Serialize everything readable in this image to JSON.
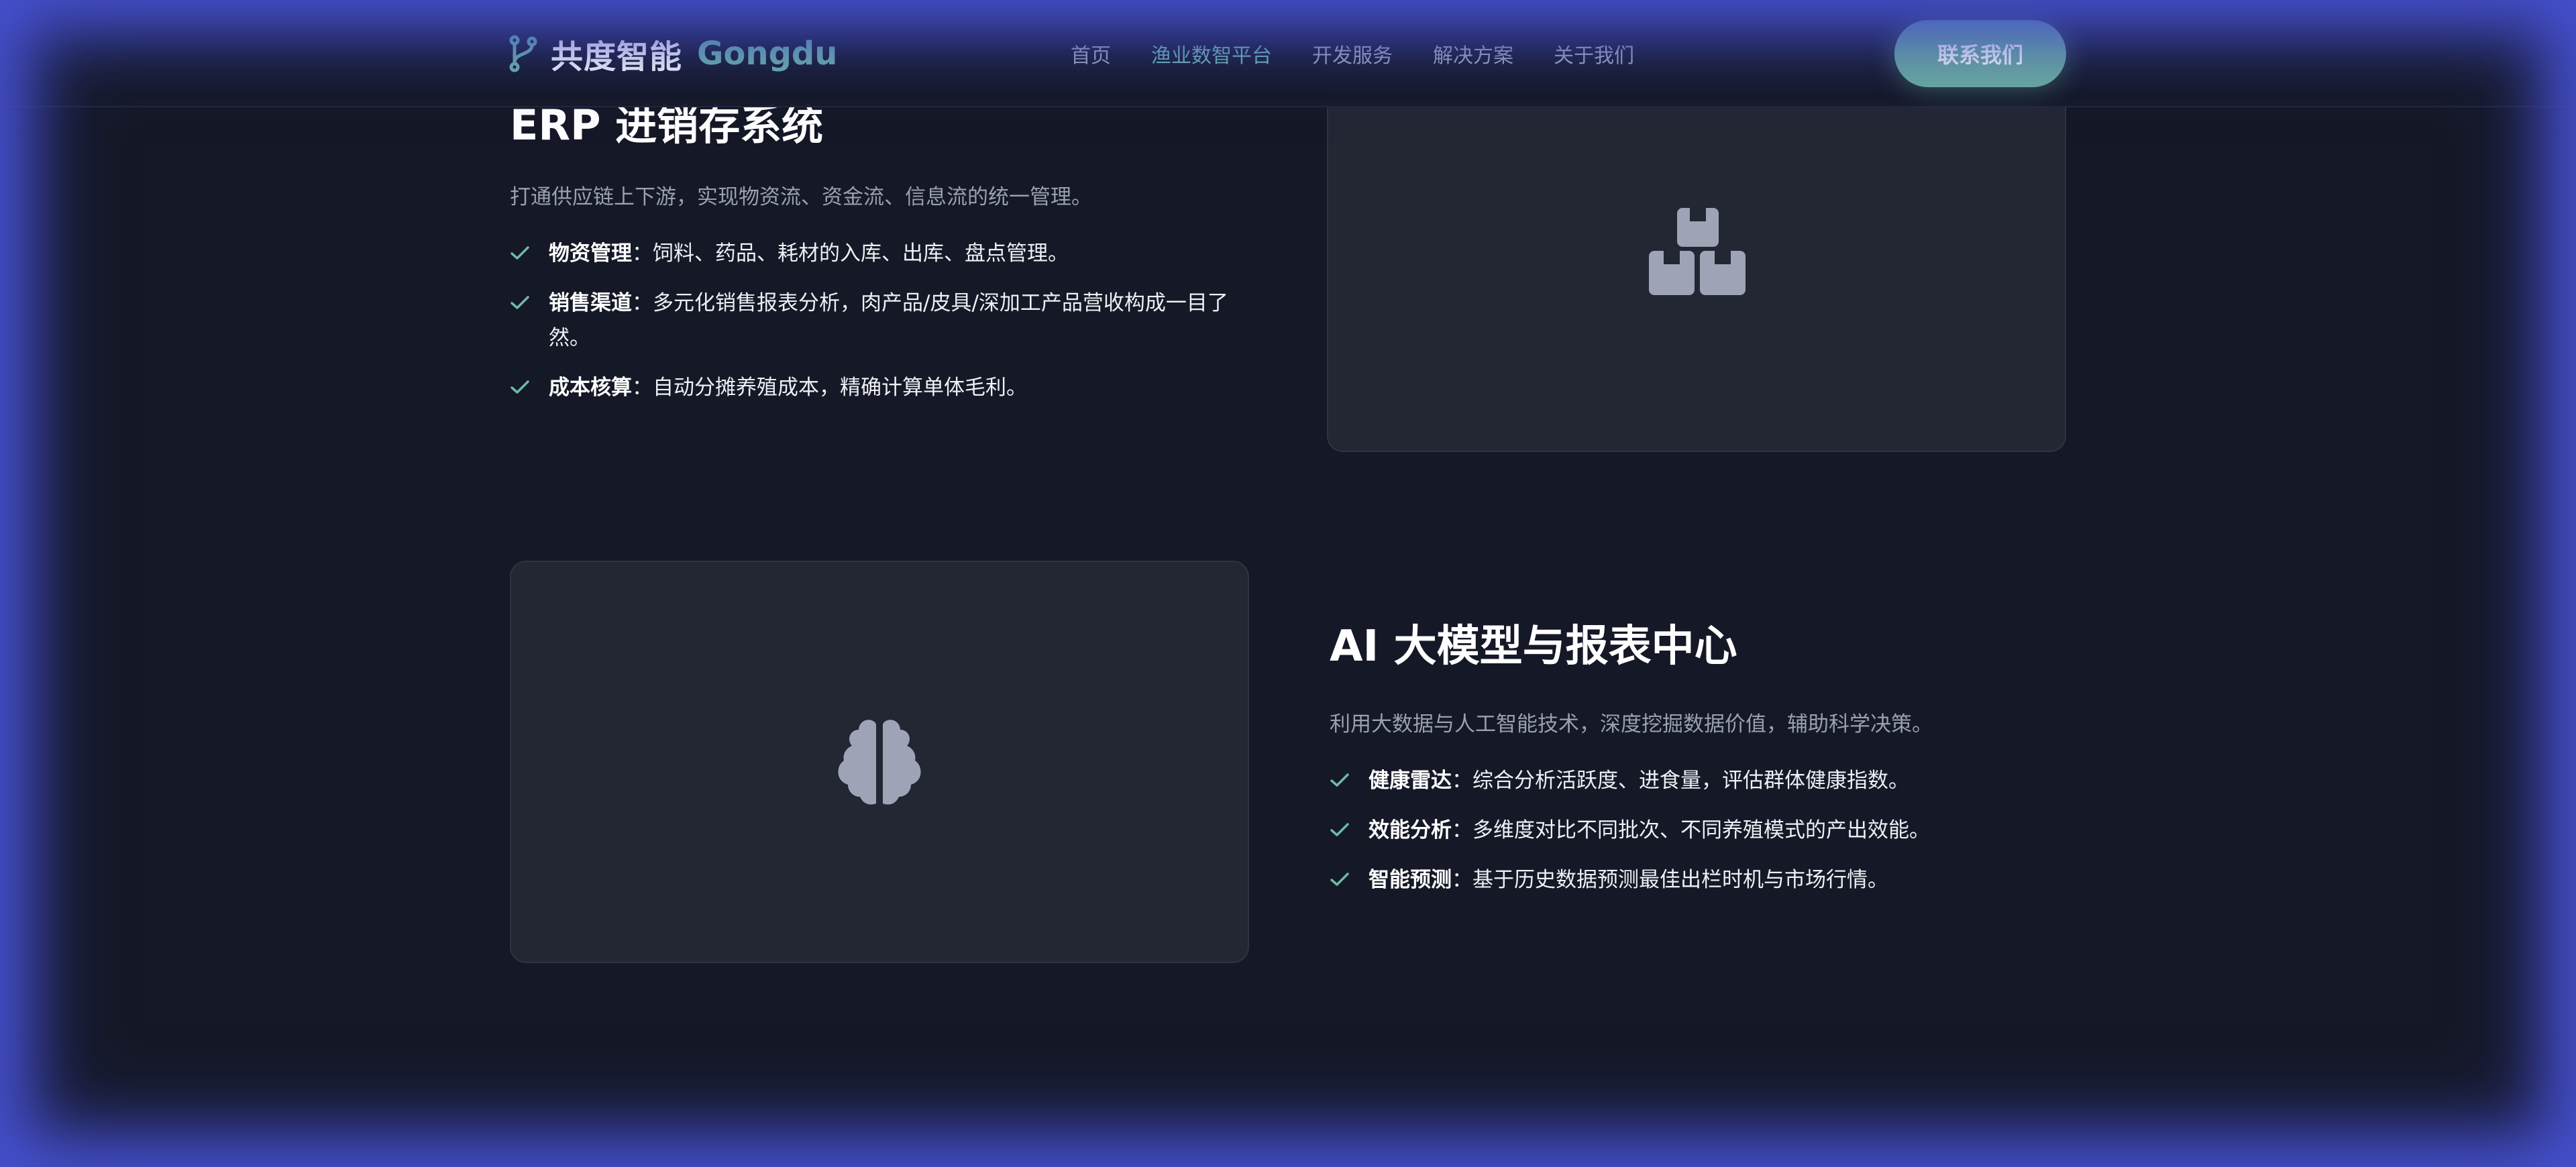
{
  "navbar": {
    "brand_name": "共度智能",
    "brand_en": "Gongdu",
    "brand_icon": "branch-icon",
    "nav_items": [
      {
        "label": "首页"
      },
      {
        "label": "渔业数智平台",
        "active": true
      },
      {
        "label": "开发服务"
      },
      {
        "label": "解决方案"
      },
      {
        "label": "关于我们"
      }
    ],
    "cta_label": "联系我们"
  },
  "erp": {
    "title": "ERP 进销存系统",
    "desc": "打通供应链上下游，实现物资流、资金流、信息流的统一管理。",
    "features": [
      {
        "name": "物资管理",
        "text": "：饲料、药品、耗材的入库、出库、盘点管理。"
      },
      {
        "name": "销售渠道",
        "text": "：多元化销售报表分析，肉产品/皮具/深加工产品营收构成一目了然。"
      },
      {
        "name": "成本核算",
        "text": "：自动分摊养殖成本，精确计算单体毛利。"
      }
    ],
    "card_icon": "boxes-icon"
  },
  "ai": {
    "title": "AI 大模型与报表中心",
    "desc": "利用大数据与人工智能技术，深度挖掘数据价值，辅助科学决策。",
    "features": [
      {
        "name": "健康雷达",
        "text": "：综合分析活跃度、进食量，评估群体健康指数。"
      },
      {
        "name": "效能分析",
        "text": "：多维度对比不同批次、不同养殖模式的产出效能。"
      },
      {
        "name": "智能预测",
        "text": "：基于历史数据预测最佳出栏时机与市场行情。"
      }
    ],
    "card_icon": "brain-icon"
  },
  "colors": {
    "accent": "#6fb9a8",
    "background": "#151826",
    "card": "#232633",
    "frame": "#4852d2"
  }
}
